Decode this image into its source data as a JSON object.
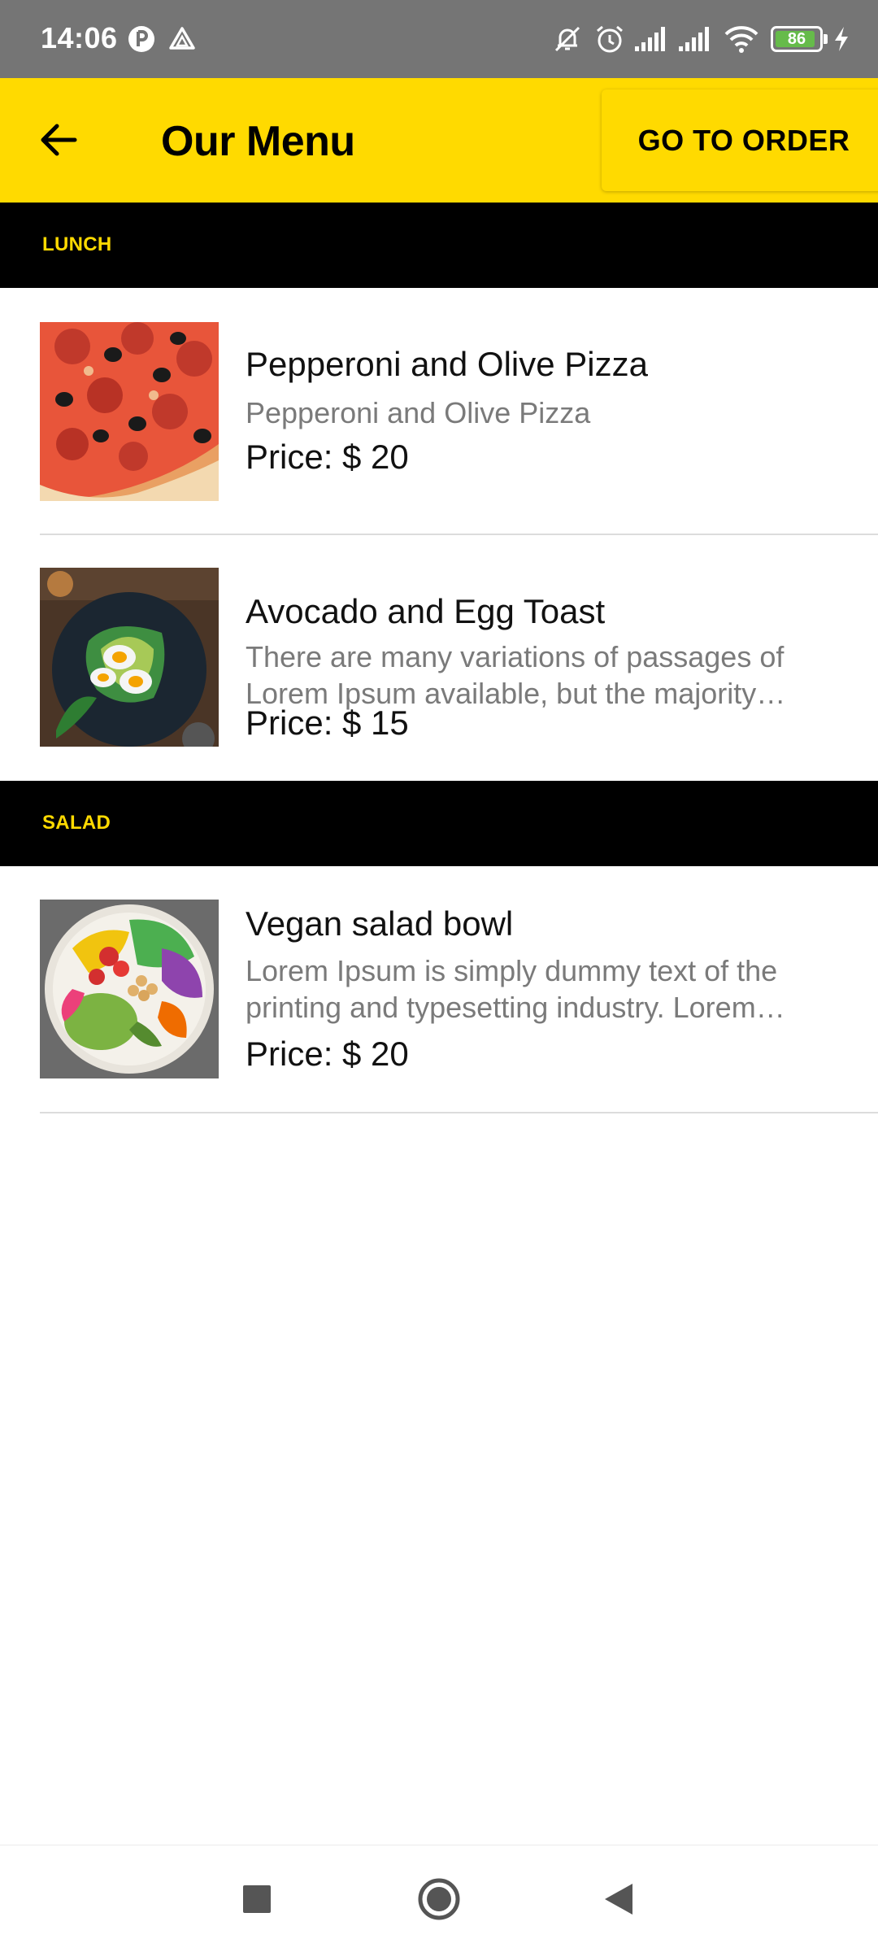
{
  "status_bar": {
    "time": "14:06",
    "battery_level": "86",
    "battery_fraction": 0.86,
    "icons": [
      "app-notification-icon",
      "drive-icon",
      "bell-off-icon",
      "alarm-icon",
      "signal-icon",
      "signal-icon",
      "wifi-icon",
      "battery-icon",
      "charging-icon"
    ]
  },
  "app_bar": {
    "title": "Our Menu",
    "back_icon": "arrow-left-icon",
    "order_button": "GO TO ORDER"
  },
  "sections": [
    {
      "label": "LUNCH",
      "items": [
        {
          "name": "Pepperoni and Olive Pizza",
          "description": "Pepperoni and Olive Pizza",
          "price": "Price: $ 20",
          "image": "pizza-photo"
        },
        {
          "name": "Avocado and Egg Toast",
          "description": "There are many variations of passages of Lorem Ipsum available, but the majority have suffered alteration",
          "price": "Price: $ 15",
          "image": "avocado-toast-photo"
        }
      ]
    },
    {
      "label": "SALAD",
      "items": [
        {
          "name": "Vegan salad bowl",
          "description": "Lorem Ipsum is simply dummy text of the printing and typesetting industry. Lorem Ipsum has been",
          "price": "Price: $ 20",
          "image": "salad-bowl-photo"
        }
      ]
    }
  ],
  "nav_bar": {
    "icons": [
      "square-recents-icon",
      "circle-home-icon",
      "triangle-back-icon"
    ]
  },
  "colors": {
    "accent": "#ffda00",
    "section_bg": "#000000",
    "status_bar": "#757575"
  }
}
